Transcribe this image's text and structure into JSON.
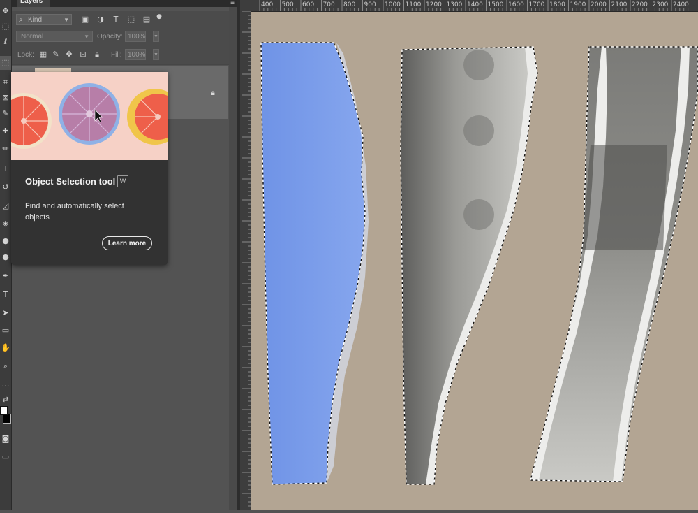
{
  "layers_panel": {
    "tab_label": "Layers",
    "kind_placeholder": "Kind",
    "blend_mode": "Normal",
    "opacity_label": "Opacity:",
    "opacity_value": "100%",
    "lock_label": "Lock:",
    "fill_label": "Fill:",
    "fill_value": "100%"
  },
  "tooltip": {
    "title": "Object Selection tool",
    "shortcut": "W",
    "description": "Find and automatically select objects",
    "learn_more_label": "Learn more"
  },
  "ruler_h_labels": [
    "400",
    "500",
    "600",
    "700",
    "800",
    "900",
    "1000",
    "1100",
    "1200",
    "1300",
    "1400",
    "1500",
    "1600",
    "1700",
    "1800",
    "1900",
    "2000",
    "2100",
    "2200",
    "2300",
    "2400"
  ],
  "colors": {
    "canvas_background": "#b3a593",
    "selection_overlay": "#7d9ee8",
    "ui_panel": "#535353",
    "tooltip_bg": "#323232"
  },
  "icons": {
    "tools": [
      "move-tool",
      "marquee-tool",
      "lasso-tool",
      "object-selection-tool",
      "crop-tool",
      "frame-tool",
      "eyedropper-tool",
      "healing-brush-tool",
      "brush-tool",
      "clone-stamp-tool",
      "history-brush-tool",
      "eraser-tool",
      "gradient-tool",
      "blur-tool",
      "dodge-tool",
      "pen-tool",
      "type-tool",
      "path-selection-tool",
      "rectangle-tool",
      "hand-tool",
      "zoom-tool",
      "more-tools",
      "swap-colors",
      "quick-mask",
      "screen-mode"
    ]
  }
}
